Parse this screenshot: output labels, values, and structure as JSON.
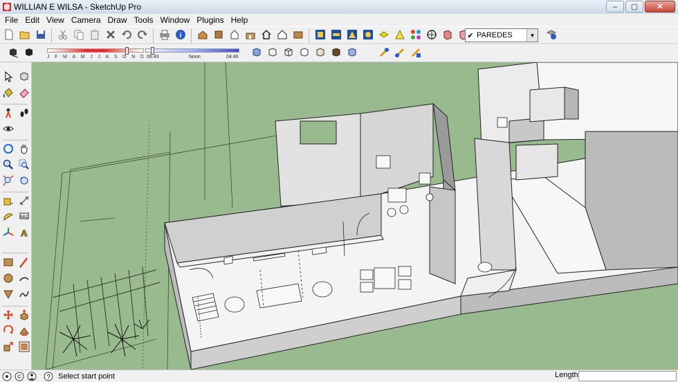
{
  "window": {
    "title": "WILLIAN E WILSA - SketchUp Pro",
    "controls": {
      "minimize": "–",
      "maximize": "▢",
      "close": "✕"
    }
  },
  "menu": [
    "File",
    "Edit",
    "View",
    "Camera",
    "Draw",
    "Tools",
    "Window",
    "Plugins",
    "Help"
  ],
  "toolbar1": {
    "buttons": [
      "new-file",
      "open-file",
      "save",
      "cut",
      "copy",
      "paste",
      "erase",
      "undo",
      "redo",
      "print",
      "model-info",
      "house-3d",
      "front-view",
      "home",
      "house-outline",
      "section-plane",
      "display-edges",
      "section-cuts",
      "component-browser",
      "materials",
      "styles",
      "layers",
      "orbit-nav",
      "walk",
      "section-views"
    ],
    "layer": {
      "checked": "✔",
      "value": "PAREDES"
    },
    "extra": "layer-manager"
  },
  "toolbar2": {
    "shadow": {
      "months": [
        "J",
        "F",
        "M",
        "A",
        "M",
        "J",
        "J",
        "A",
        "S",
        "O",
        "N",
        "D"
      ],
      "month_position": 0.83,
      "time_start": "06:43",
      "time_noon": "Noon",
      "time_end": "04:46",
      "time_position": 0.05
    },
    "buttons": [
      "shadow-toggle",
      "fog",
      "xray",
      "back-edges",
      "wireframe",
      "hidden-line",
      "shaded",
      "shaded-textures",
      "monochrome",
      "add-location",
      "photo-textures",
      "geo-toggle"
    ]
  },
  "left_tools": [
    [
      "select",
      "make-component"
    ],
    [
      "paint-bucket",
      "eraser"
    ],
    [
      "position-camera",
      "footprints"
    ],
    [
      "look-around",
      "section-plane-tool"
    ],
    [
      "orbit",
      "pan"
    ],
    [
      "zoom",
      "zoom-window"
    ],
    [
      "zoom-extents",
      "previous-view"
    ],
    [
      "tape-measure",
      "dimension"
    ],
    [
      "protractor",
      "text-tool"
    ],
    [
      "axes",
      "3d-text"
    ],
    [
      "rectangle",
      "line"
    ],
    [
      "circle",
      "arc"
    ],
    [
      "polygon",
      "freehand"
    ],
    [
      "move",
      "push-pull"
    ],
    [
      "rotate",
      "follow-me"
    ],
    [
      "scale",
      "offset"
    ]
  ],
  "status": {
    "icons": [
      "geo-location-icon",
      "credits-icon",
      "user-icon"
    ],
    "help_icon": "?",
    "message": "Select start point",
    "vcb_label": "Length",
    "vcb_value": ""
  },
  "colors": {
    "viewport_ground": "#99ba8e",
    "wall_top": "#f7f7f7",
    "wall_dark": "#9c9c9c",
    "wall_mid": "#c4c4c4"
  }
}
